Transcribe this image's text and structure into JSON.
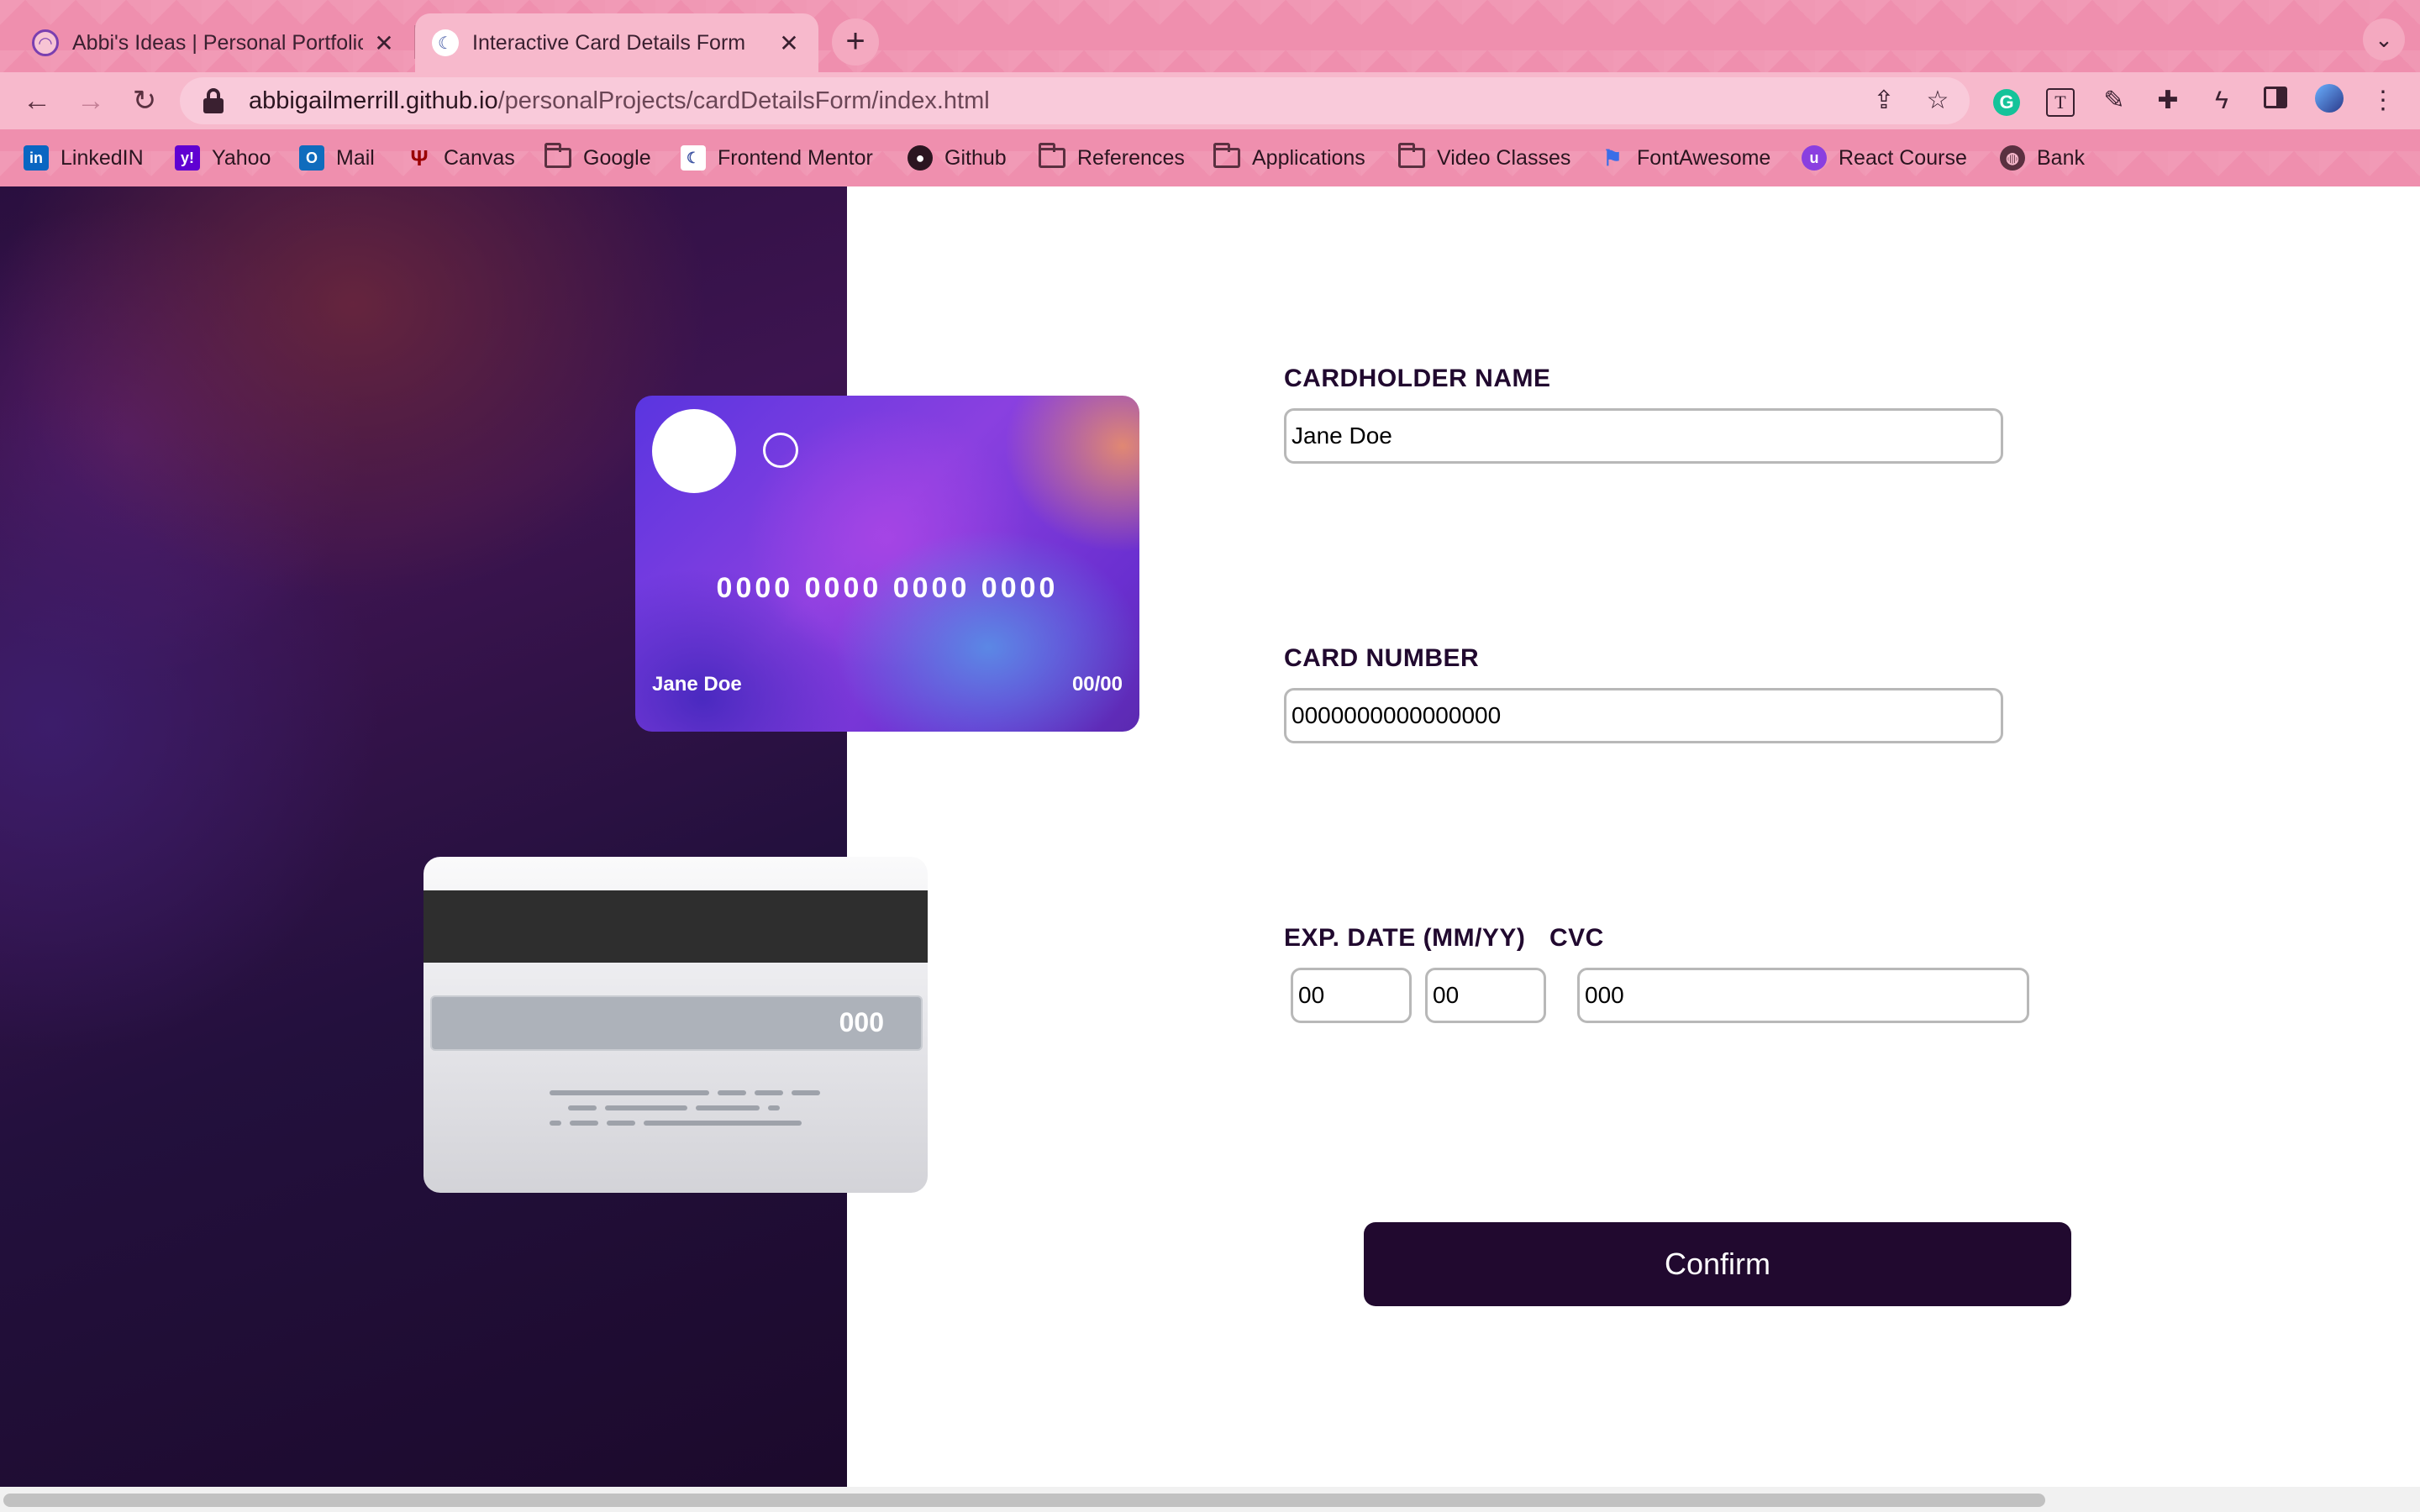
{
  "browser": {
    "tabs": [
      {
        "title": "Abbi's Ideas | Personal Portfolio",
        "active": false,
        "icon": "abbi-logo-icon"
      },
      {
        "title": "Interactive Card Details Form",
        "active": true,
        "icon": "frontend-mentor-icon"
      }
    ],
    "new_tab_label": "+",
    "tab_menu_label": "⌄",
    "url_host": "abbigailmerrill.github.io",
    "url_path": "/personalProjects/cardDetailsForm/index.html",
    "bookmarks": [
      {
        "label": "LinkedIN",
        "icon": "linkedin-icon"
      },
      {
        "label": "Yahoo",
        "icon": "yahoo-icon"
      },
      {
        "label": "Mail",
        "icon": "outlook-icon"
      },
      {
        "label": "Canvas",
        "icon": "iu-icon"
      },
      {
        "label": "Google",
        "icon": "folder-icon"
      },
      {
        "label": "Frontend Mentor",
        "icon": "frontend-mentor-icon"
      },
      {
        "label": "Github",
        "icon": "github-icon"
      },
      {
        "label": "References",
        "icon": "folder-icon"
      },
      {
        "label": "Applications",
        "icon": "folder-icon"
      },
      {
        "label": "Video Classes",
        "icon": "folder-icon"
      },
      {
        "label": "FontAwesome",
        "icon": "fontawesome-icon"
      },
      {
        "label": "React Course",
        "icon": "react-course-icon"
      },
      {
        "label": "Bank",
        "icon": "globe-icon"
      }
    ],
    "colors": {
      "chrome": "#ef8fae",
      "active_tab": "#f7b9cc"
    }
  },
  "card_front": {
    "number": "0000 0000 0000 0000",
    "name": "Jane Doe",
    "expiry": "00/00"
  },
  "card_back": {
    "cvc": "000"
  },
  "form": {
    "cardholder_label": "CARDHOLDER NAME",
    "cardholder_value": "Jane Doe",
    "number_label": "CARD NUMBER",
    "number_value": "0000000000000000",
    "exp_label": "EXP. DATE (MM/YY)",
    "cvc_label": "CVC",
    "exp_month_value": "00",
    "exp_year_value": "00",
    "cvc_value": "000",
    "confirm_label": "Confirm"
  },
  "theme": {
    "dark": "#21092f",
    "field_border": "#b8b8b8"
  }
}
